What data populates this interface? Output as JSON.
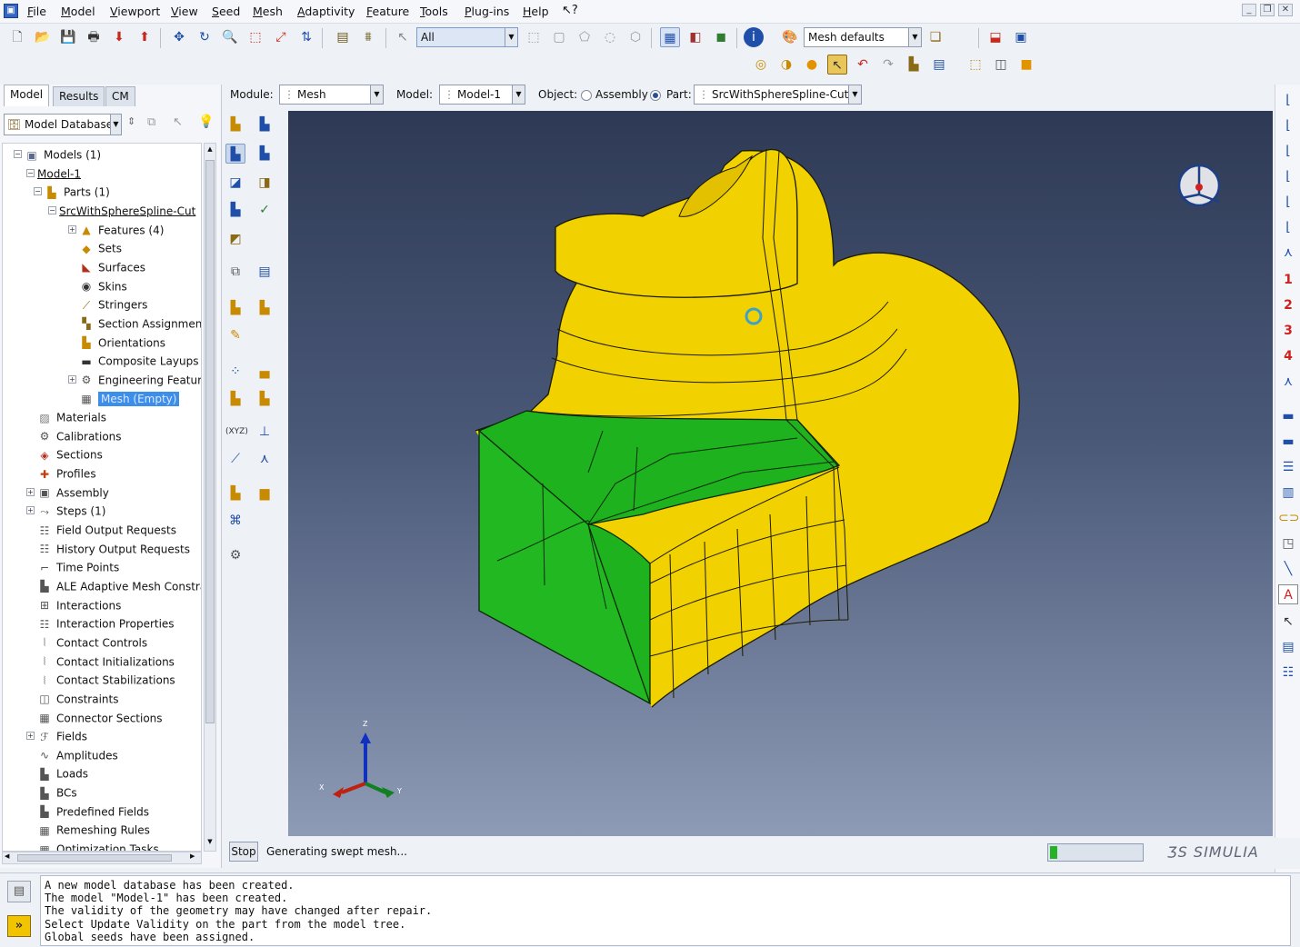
{
  "menu": [
    "File",
    "Model",
    "Viewport",
    "View",
    "Seed",
    "Mesh",
    "Adaptivity",
    "Feature",
    "Tools",
    "Plug-ins",
    "Help"
  ],
  "toolbar": {
    "selection_filter": "All",
    "mesh_defaults": "Mesh defaults"
  },
  "tabs": [
    "Model",
    "Results",
    "CM"
  ],
  "tree": {
    "database_label": "Model Database",
    "items": [
      {
        "label": "Models (1)",
        "level": 0,
        "icon": "models-icon",
        "exp": "minus"
      },
      {
        "label": "Model-1",
        "level": 1,
        "icon": "",
        "exp": "minus",
        "underline": true
      },
      {
        "label": "Parts (1)",
        "level": 2,
        "icon": "parts-icon",
        "exp": "minus"
      },
      {
        "label": "SrcWithSphereSpline-Cut",
        "level": 3,
        "icon": "",
        "exp": "minus",
        "underline": true
      },
      {
        "label": "Features (4)",
        "level": 4,
        "icon": "features-icon",
        "exp": "plus"
      },
      {
        "label": "Sets",
        "level": 4,
        "icon": "sets-icon",
        "exp": ""
      },
      {
        "label": "Surfaces",
        "level": 4,
        "icon": "surfaces-icon",
        "exp": ""
      },
      {
        "label": "Skins",
        "level": 4,
        "icon": "skins-icon",
        "exp": ""
      },
      {
        "label": "Stringers",
        "level": 4,
        "icon": "stringers-icon",
        "exp": ""
      },
      {
        "label": "Section Assignments",
        "level": 4,
        "icon": "section-assign-icon",
        "exp": ""
      },
      {
        "label": "Orientations",
        "level": 4,
        "icon": "orientations-icon",
        "exp": ""
      },
      {
        "label": "Composite Layups",
        "level": 4,
        "icon": "layups-icon",
        "exp": ""
      },
      {
        "label": "Engineering Features",
        "level": 4,
        "icon": "eng-features-icon",
        "exp": "plus"
      },
      {
        "label": "Mesh (Empty)",
        "level": 4,
        "icon": "mesh-icon",
        "exp": "",
        "selected": true
      },
      {
        "label": "Materials",
        "level": 1,
        "icon": "materials-icon",
        "exp": ""
      },
      {
        "label": "Calibrations",
        "level": 1,
        "icon": "calibrations-icon",
        "exp": ""
      },
      {
        "label": "Sections",
        "level": 1,
        "icon": "sections-icon",
        "exp": ""
      },
      {
        "label": "Profiles",
        "level": 1,
        "icon": "profiles-icon",
        "exp": ""
      },
      {
        "label": "Assembly",
        "level": 1,
        "icon": "assembly-icon",
        "exp": "plus"
      },
      {
        "label": "Steps (1)",
        "level": 1,
        "icon": "steps-icon",
        "exp": "plus"
      },
      {
        "label": "Field Output Requests",
        "level": 1,
        "icon": "field-output-icon",
        "exp": ""
      },
      {
        "label": "History Output Requests",
        "level": 1,
        "icon": "history-output-icon",
        "exp": ""
      },
      {
        "label": "Time Points",
        "level": 1,
        "icon": "time-points-icon",
        "exp": ""
      },
      {
        "label": "ALE Adaptive Mesh Constraints",
        "level": 1,
        "icon": "ale-icon",
        "exp": ""
      },
      {
        "label": "Interactions",
        "level": 1,
        "icon": "interactions-icon",
        "exp": ""
      },
      {
        "label": "Interaction Properties",
        "level": 1,
        "icon": "interaction-props-icon",
        "exp": ""
      },
      {
        "label": "Contact Controls",
        "level": 1,
        "icon": "contact-controls-icon",
        "exp": ""
      },
      {
        "label": "Contact Initializations",
        "level": 1,
        "icon": "contact-init-icon",
        "exp": ""
      },
      {
        "label": "Contact Stabilizations",
        "level": 1,
        "icon": "contact-stab-icon",
        "exp": ""
      },
      {
        "label": "Constraints",
        "level": 1,
        "icon": "constraints-icon",
        "exp": ""
      },
      {
        "label": "Connector Sections",
        "level": 1,
        "icon": "connector-icon",
        "exp": ""
      },
      {
        "label": "Fields",
        "level": 1,
        "icon": "fields-icon",
        "exp": "plus"
      },
      {
        "label": "Amplitudes",
        "level": 1,
        "icon": "amplitudes-icon",
        "exp": ""
      },
      {
        "label": "Loads",
        "level": 1,
        "icon": "loads-icon",
        "exp": ""
      },
      {
        "label": "BCs",
        "level": 1,
        "icon": "bcs-icon",
        "exp": ""
      },
      {
        "label": "Predefined Fields",
        "level": 1,
        "icon": "predefined-icon",
        "exp": ""
      },
      {
        "label": "Remeshing Rules",
        "level": 1,
        "icon": "remeshing-icon",
        "exp": ""
      },
      {
        "label": "Optimization Tasks",
        "level": 1,
        "icon": "optimization-icon",
        "exp": ""
      }
    ]
  },
  "context": {
    "module_label": "Module:",
    "module_value": "Mesh",
    "model_label": "Model:",
    "model_value": "Model-1",
    "object_label": "Object:",
    "assembly_label": "Assembly",
    "part_label": "Part:",
    "part_value": "SrcWithSphereSpline-Cut"
  },
  "triad": {
    "x": "X",
    "y": "Y",
    "z": "Z"
  },
  "status": {
    "stop_label": "Stop",
    "prompt_text": "Generating swept mesh...",
    "progress": 0.08,
    "brand": "SIMULIA"
  },
  "messages": [
    "A new model database has been created.",
    "The model \"Model-1\" has been created.",
    "The validity of the geometry may have changed after repair.",
    "Select Update Validity on the part from the model tree.",
    "Global seeds have been assigned."
  ],
  "right_numbers": [
    "1",
    "2",
    "3",
    "4"
  ],
  "colors": {
    "part_yellow": "#f2d100",
    "part_green": "#1fb21f",
    "viewport_top": "#2e3a55",
    "viewport_bottom": "#8d9bb6",
    "selection_blue": "#3d8ee8"
  }
}
